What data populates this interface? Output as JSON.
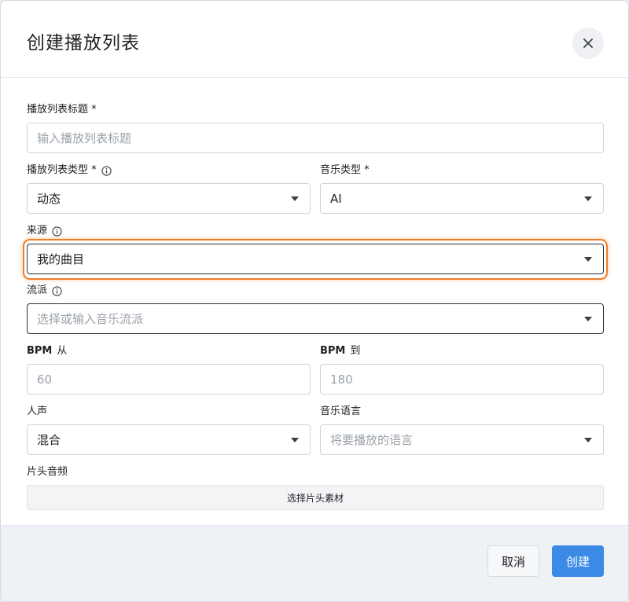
{
  "dialog": {
    "title": "创建播放列表",
    "close_icon": "close-icon"
  },
  "form": {
    "title_field": {
      "label": "播放列表标题 *",
      "placeholder": "输入播放列表标题"
    },
    "playlist_type": {
      "label": "播放列表类型 *",
      "value": "动态"
    },
    "music_type": {
      "label": "音乐类型 *",
      "value": "AI"
    },
    "source": {
      "label": "来源",
      "value": "我的曲目"
    },
    "genre": {
      "label": "流派",
      "placeholder": "选择或输入音乐流派"
    },
    "bpm_from": {
      "label_en": "BPM",
      "label_zh": "从",
      "placeholder": "60"
    },
    "bpm_to": {
      "label_en": "BPM",
      "label_zh": "到",
      "placeholder": "180"
    },
    "vocals": {
      "label": "人声",
      "value": "混合"
    },
    "music_language": {
      "label": "音乐语言",
      "placeholder": "将要播放的语言"
    },
    "intro_audio": {
      "label": "片头音频",
      "button_label": "选择片头素材"
    }
  },
  "footer": {
    "cancel_label": "取消",
    "create_label": "创建"
  },
  "colors": {
    "accent": "#3b8ae6",
    "focus_ring": "#f07d28",
    "footer_bg": "#eef1f5"
  }
}
